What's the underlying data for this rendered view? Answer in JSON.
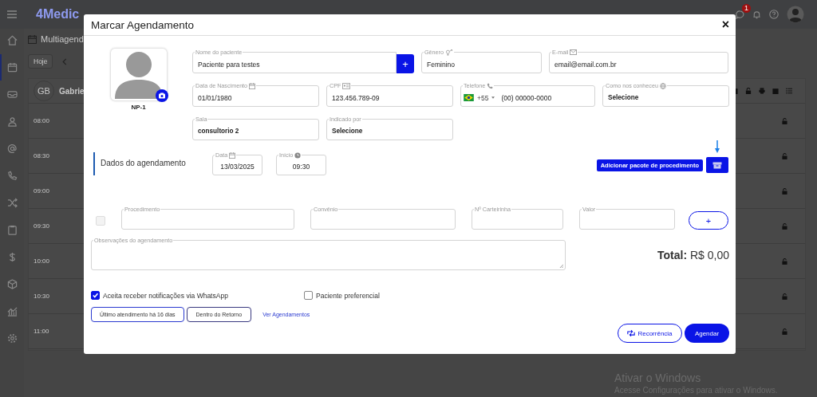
{
  "app": {
    "logo": "4Medic",
    "notification_count": "1",
    "sidebar": [
      {
        "selected": false
      },
      {
        "selected": true
      },
      {
        "selected": false
      },
      {
        "selected": false
      },
      {
        "selected": false
      },
      {
        "selected": false
      },
      {
        "selected": false
      },
      {
        "selected": false
      },
      {
        "selected": false
      },
      {
        "selected": false
      },
      {
        "selected": false
      },
      {
        "selected": false
      }
    ],
    "page_title": "Multiagend",
    "today_button": "Hoje",
    "professional_initials": "GB",
    "professional_name": "Gabrie",
    "time_slots": [
      "08:00",
      "08:30",
      "09:00",
      "09:30",
      "10:00",
      "10:30",
      "11:00"
    ]
  },
  "modal": {
    "title": "Marcar Agendamento",
    "close": "×",
    "photo_caption": "NP-1",
    "add_patient_button": "+",
    "patient_rows": [
      [
        {
          "kind": "text",
          "label": "Nome do paciente",
          "value": "Paciente para testes"
        },
        {
          "kind": "text",
          "label": "Gênero",
          "value": "Feminino"
        },
        {
          "kind": "text",
          "label": "E-mail",
          "value": "email@email.com.br"
        }
      ],
      [
        {
          "kind": "text",
          "label": "Data de Nascimento",
          "value": "01/01/1980"
        },
        {
          "kind": "text",
          "label": "CPF",
          "value": "123.456.789-09"
        },
        {
          "kind": "phone",
          "label": "Telefone",
          "country_code": "+55",
          "value": "(00) 00000-0000"
        },
        {
          "kind": "select",
          "label": "Como nos conheceu",
          "value": "Selecione"
        }
      ],
      [
        {
          "kind": "select",
          "label": "Sala",
          "value": "consultorio 2"
        },
        {
          "kind": "select",
          "label": "Indicado por",
          "value": "Selecione"
        }
      ]
    ],
    "section_title": "Dados do agendamento",
    "schedule_fields": [
      {
        "label": "Data",
        "value": "13/03/2025"
      },
      {
        "label": "Início",
        "value": "09:30"
      }
    ],
    "package_tooltip": "Adicionar pacote de procedimento",
    "procedure": {
      "checked": false,
      "fields": [
        {
          "label": "Procedimento"
        },
        {
          "label": "Convênio"
        },
        {
          "label": "Nº Carteirinha"
        },
        {
          "label": "Valor"
        }
      ],
      "add_button": "+"
    },
    "notes": {
      "label": "Observações do agendamento"
    },
    "total_label": "Total:",
    "total_value": "R$ 0,00",
    "options": [
      {
        "label": "Aceita receber notificações via WhatsApp",
        "checked": true
      },
      {
        "label": "Paciente preferencial",
        "checked": false
      }
    ],
    "tags": [
      "Último atendimento há 16 dias",
      "Dentro do Retorno"
    ],
    "link": "Ver Agendamentos",
    "buttons": [
      {
        "kind": "outline",
        "label": "Recorrência"
      },
      {
        "kind": "primary",
        "label": "Agendar"
      }
    ]
  },
  "windows_notice": {
    "title": "Ativar o Windows",
    "text": "Acesse Configurações para ativar o Windows."
  }
}
